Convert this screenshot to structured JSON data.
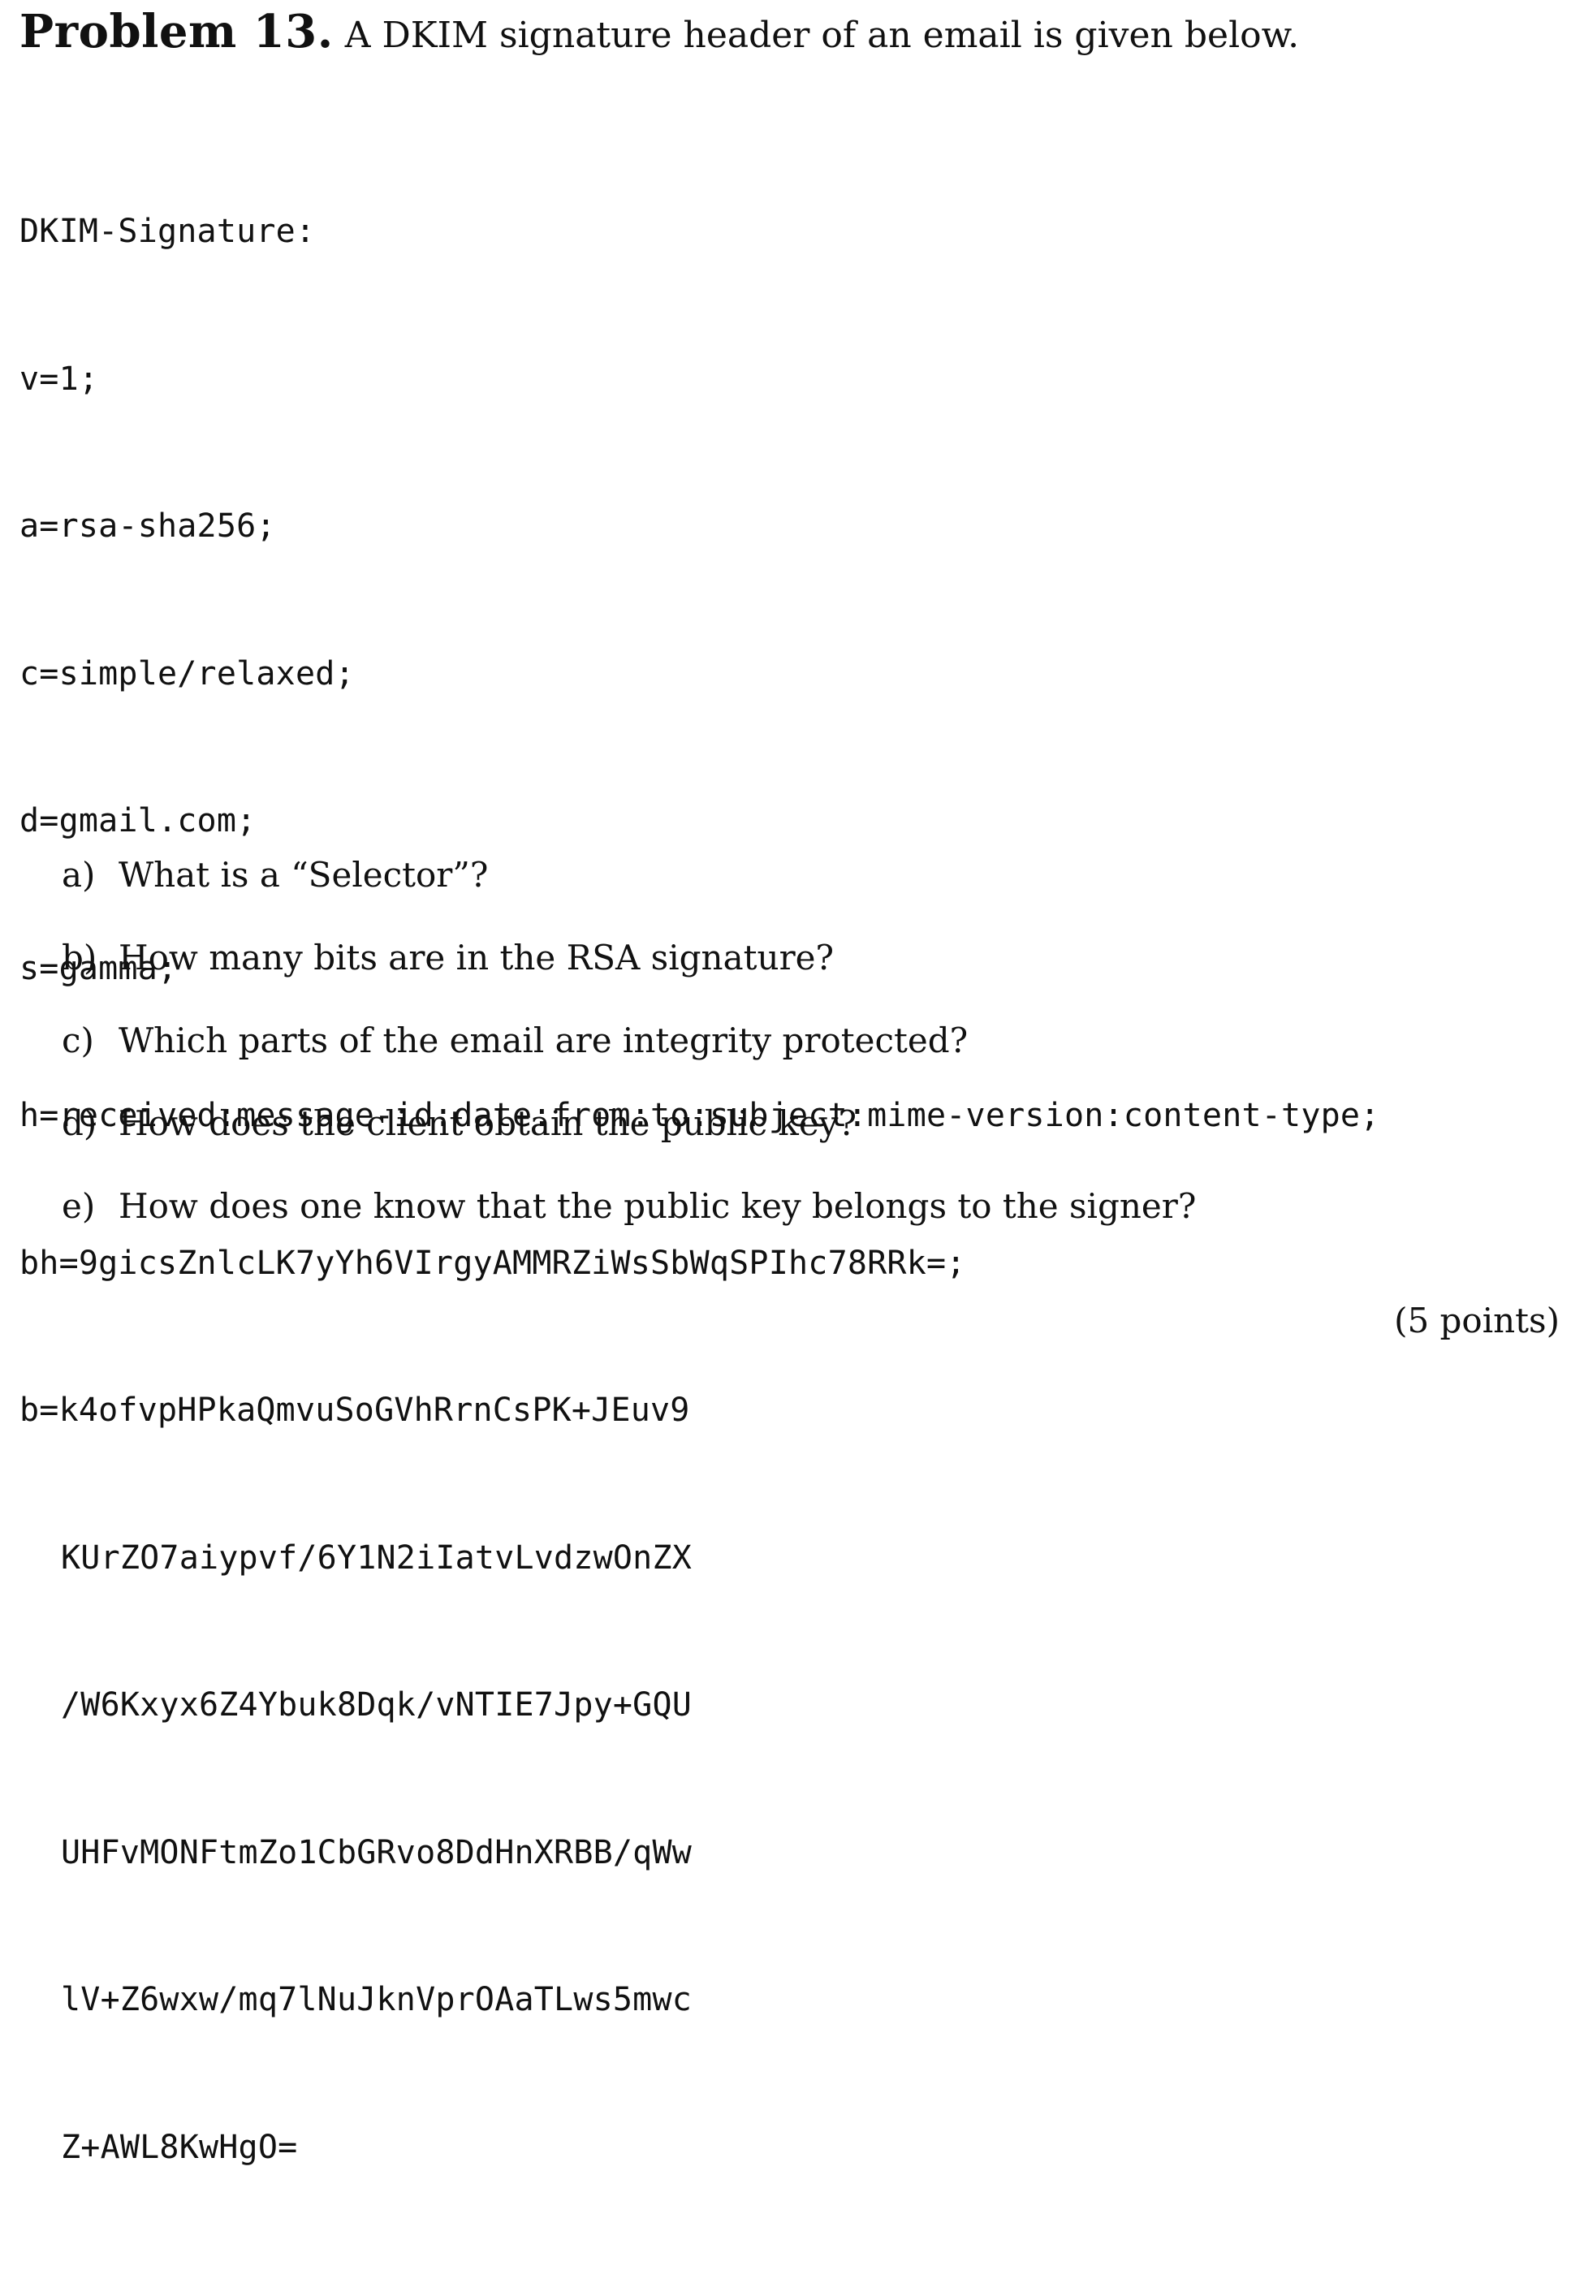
{
  "problem": {
    "label": "Problem 13.",
    "intro": "A DKIM signature header of an email is given below."
  },
  "dkim": {
    "header_name": "DKIM-Signature:",
    "v": "v=1;",
    "a": "a=rsa-sha256;",
    "c": "c=simple/relaxed;",
    "d": "d=gmail.com;",
    "s": "s=gamma;",
    "h": "h=received:message-id:date:from:to:subject:mime-version:content-type;",
    "bh": "bh=9gicsZnlcLK7yYh6VIrgyAMMRZiWsSbWqSPIhc78RRk=;",
    "b_lines": [
      "b=k4ofvpHPkaQmvuSoGVhRrnCsPK+JEuv9",
      "KUrZO7aiypvf/6Y1N2iIatvLvdzwOnZX",
      "/W6Kxyx6Z4Ybuk8Dqk/vNTIE7Jpy+GQU",
      "UHFvMONFtmZo1CbGRvo8DdHnXRBB/qWw",
      "lV+Z6wxw/mq7lNuJknVprOAaTLws5mwc",
      "Z+AWL8KwHgO="
    ]
  },
  "questions": [
    {
      "letter": "a)",
      "text": "What is a “Selector”?"
    },
    {
      "letter": "b)",
      "text": "How many bits are in the RSA signature?"
    },
    {
      "letter": "c)",
      "text": "Which parts of the email are integrity protected?"
    },
    {
      "letter": "d)",
      "text": "How does the client obtain the public key?"
    },
    {
      "letter": "e)",
      "text": "How does one know that the public key belongs to the signer?"
    }
  ],
  "points": "(5 points)"
}
